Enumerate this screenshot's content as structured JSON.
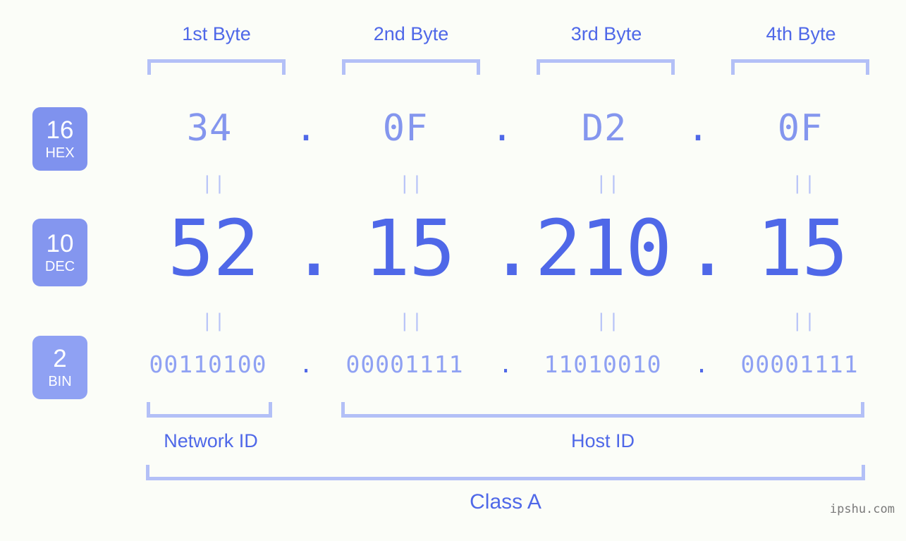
{
  "watermark": "ipshu.com",
  "colors": {
    "background": "#fbfdf8",
    "accent_strong": "#4f68e8",
    "accent_light": "#8496ee",
    "accent_lighter": "#8fa1f3",
    "bracket": "#b3c0f7",
    "equals": "#b8c4f8",
    "badge_hex": "#7f92ee",
    "badge_dec": "#8496ef",
    "badge_bin": "#8fa1f3",
    "watermark": "#7a7a7a"
  },
  "byte_headers": [
    {
      "label": "1st Byte"
    },
    {
      "label": "2nd Byte"
    },
    {
      "label": "3rd Byte"
    },
    {
      "label": "4th Byte"
    }
  ],
  "bases": [
    {
      "key": "hex",
      "number": "16",
      "name": "HEX"
    },
    {
      "key": "dec",
      "number": "10",
      "name": "DEC"
    },
    {
      "key": "bin",
      "number": "2",
      "name": "BIN"
    }
  ],
  "separator": ".",
  "equals_glyph": "||",
  "rows": {
    "hex": {
      "values": [
        "34",
        "0F",
        "D2",
        "0F"
      ]
    },
    "dec": {
      "values": [
        "52",
        "15",
        "210",
        "15"
      ]
    },
    "bin": {
      "values": [
        "00110100",
        "00001111",
        "11010010",
        "00001111"
      ]
    }
  },
  "ip": {
    "hex": "34.0F.D2.0F",
    "dec": "52.15.210.15",
    "bin": "00110100.00001111.11010010.00001111"
  },
  "id_labels": {
    "network": "Network ID",
    "host": "Host ID"
  },
  "class_label": "Class A"
}
